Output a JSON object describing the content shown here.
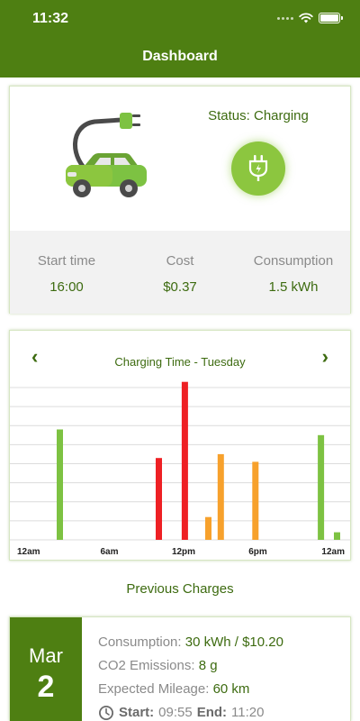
{
  "status_bar": {
    "time": "11:32"
  },
  "header": {
    "title": "Dashboard"
  },
  "status_card": {
    "status_label": "Status: Charging",
    "stats": [
      {
        "label": "Start time",
        "value": "16:00"
      },
      {
        "label": "Cost",
        "value": "$0.37"
      },
      {
        "label": "Consumption",
        "value": "1.5 kWh"
      }
    ]
  },
  "chart_card": {
    "prev_label": "‹",
    "next_label": "›",
    "title": "Charging Time - Tuesday"
  },
  "chart_data": {
    "type": "bar",
    "title": "Charging Time - Tuesday",
    "xlabel": "",
    "ylabel": "",
    "x_ticks": [
      "12am",
      "6am",
      "12pm",
      "6pm",
      "12am"
    ],
    "x_range": [
      0,
      24
    ],
    "ylim": [
      0,
      8
    ],
    "grid": true,
    "bars": [
      {
        "hour": 2,
        "value": 5.8,
        "color": "#7dc242"
      },
      {
        "hour": 10,
        "value": 4.3,
        "color": "#ee2024"
      },
      {
        "hour": 12.1,
        "value": 8.3,
        "color": "#ee2024"
      },
      {
        "hour": 14,
        "value": 1.2,
        "color": "#f7a12c"
      },
      {
        "hour": 15,
        "value": 4.5,
        "color": "#f7a12c"
      },
      {
        "hour": 17.8,
        "value": 4.1,
        "color": "#f7a12c"
      },
      {
        "hour": 23.1,
        "value": 5.5,
        "color": "#7dc242"
      },
      {
        "hour": 24.4,
        "value": 0.4,
        "color": "#7dc242"
      }
    ]
  },
  "previous": {
    "title": "Previous Charges",
    "items": [
      {
        "month": "Mar",
        "day": "2",
        "consumption_label": "Consumption:",
        "consumption_value": "30 kWh / $10.20",
        "co2_label": "CO2 Emissions:",
        "co2_value": "8 g",
        "mileage_label": "Expected Mileage:",
        "mileage_value": "60 km",
        "start_label": "Start:",
        "start_value": "09:55",
        "end_label": "End:",
        "end_value": "11:20"
      }
    ]
  },
  "colors": {
    "primary": "#4e7f12",
    "accent": "#8cc63f",
    "text_green": "#3d6b10",
    "bar_green": "#7dc242",
    "bar_red": "#ee2024",
    "bar_orange": "#f7a12c"
  },
  "icons": [
    "wifi-icon",
    "battery-icon",
    "ev-car-icon",
    "plug-icon",
    "clock-icon",
    "chevron-left-icon",
    "chevron-right-icon"
  ]
}
